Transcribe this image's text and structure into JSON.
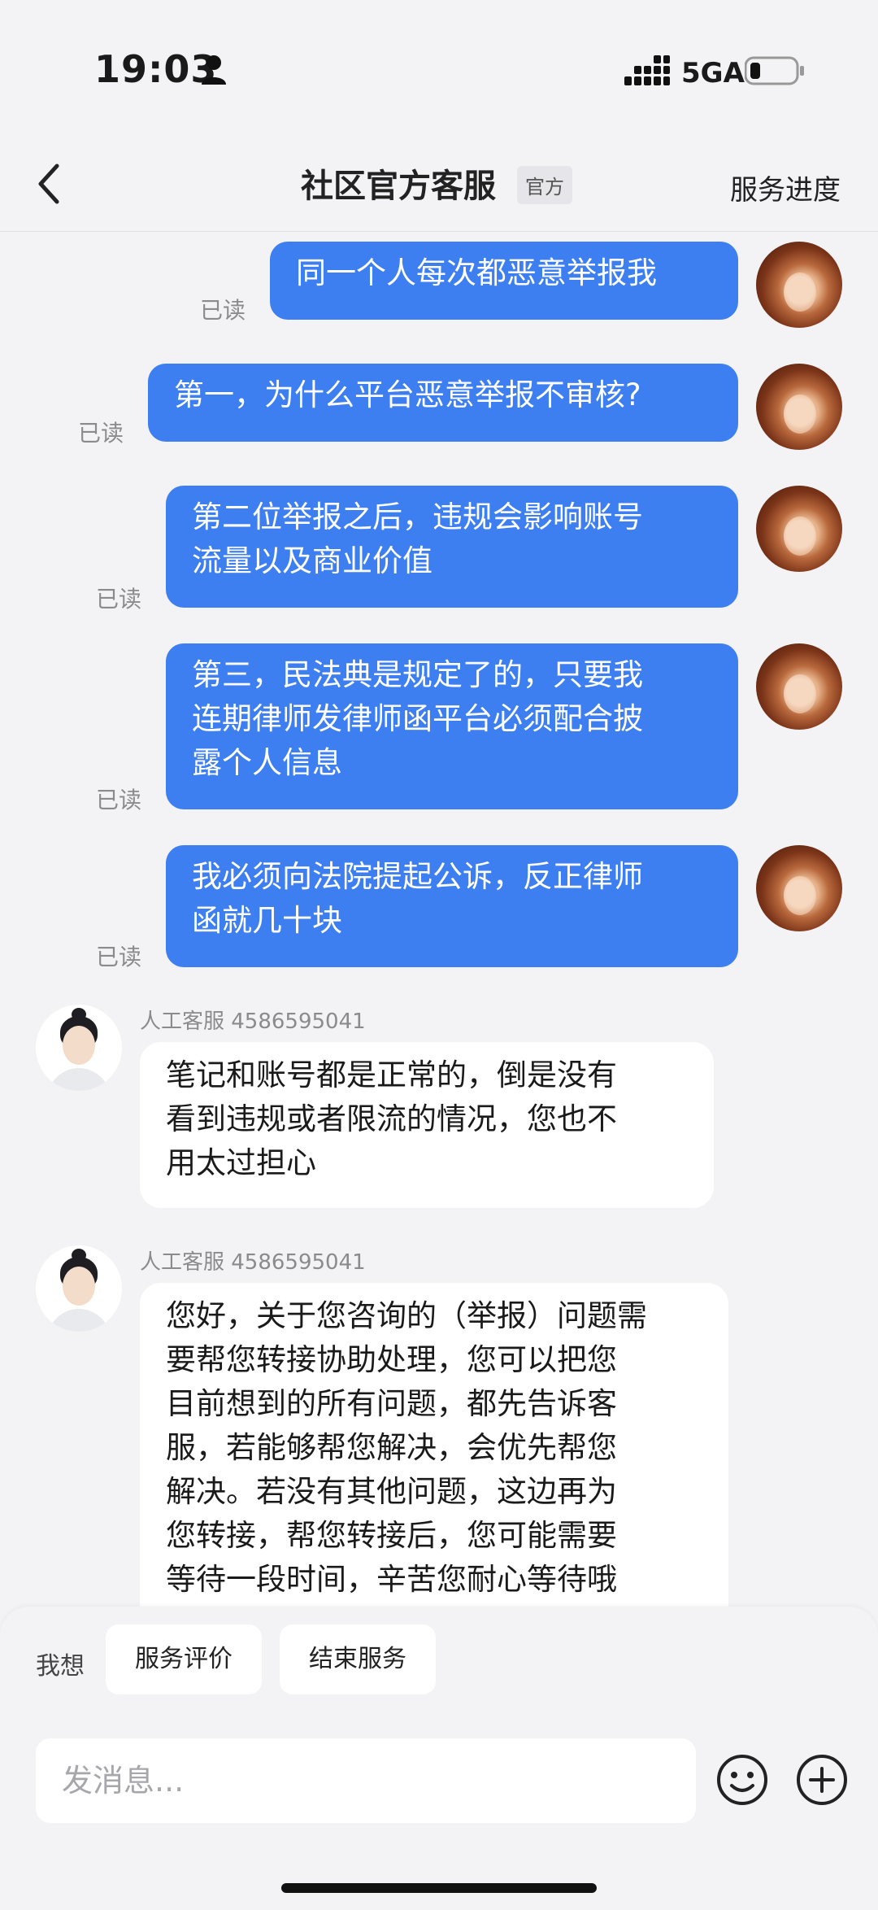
{
  "status_bar": {
    "time": "19:03",
    "network": "5GA"
  },
  "header": {
    "title": "社区官方客服",
    "badge": "官方",
    "right_link": "服务进度"
  },
  "messages": [
    {
      "from": "me",
      "text": "同一个人每次都恶意举报我",
      "status": "已读"
    },
    {
      "from": "me",
      "text": "第一，为什么平台恶意举报不审核?",
      "status": "已读"
    },
    {
      "from": "me",
      "lines": [
        "第二位举报之后，违规会影响账号",
        "流量以及商业价值"
      ],
      "status": "已读"
    },
    {
      "from": "me",
      "lines": [
        "第三，民法典是规定了的，只要我",
        "连期律师发律师函平台必须配合披",
        "露个人信息"
      ],
      "status": "已读"
    },
    {
      "from": "me",
      "lines": [
        "我必须向法院提起公诉，反正律师",
        "函就几十块"
      ],
      "status": "已读"
    },
    {
      "from": "agent",
      "name": "人工客服 4586595041",
      "lines": [
        "笔记和账号都是正常的，倒是没有",
        "看到违规或者限流的情况，您也不",
        "用太过担心"
      ]
    },
    {
      "from": "agent",
      "name": "人工客服 4586595041",
      "lines": [
        "您好，关于您咨询的（举报）问题需",
        "要帮您转接协助处理，您可以把您",
        "目前想到的所有问题，都先告诉客",
        "服，若能够帮您解决，会优先帮您",
        "解决。若没有其他问题，这边再为",
        "您转接，帮您转接后，您可能需要",
        "等待一段时间，辛苦您耐心等待哦"
      ]
    }
  ],
  "bottom": {
    "want_label": "我想",
    "chips": [
      "服务评价",
      "结束服务"
    ],
    "input_placeholder": "发消息..."
  },
  "colors": {
    "my_bubble": "#3d7ef0",
    "background": "#f3f3f5"
  }
}
